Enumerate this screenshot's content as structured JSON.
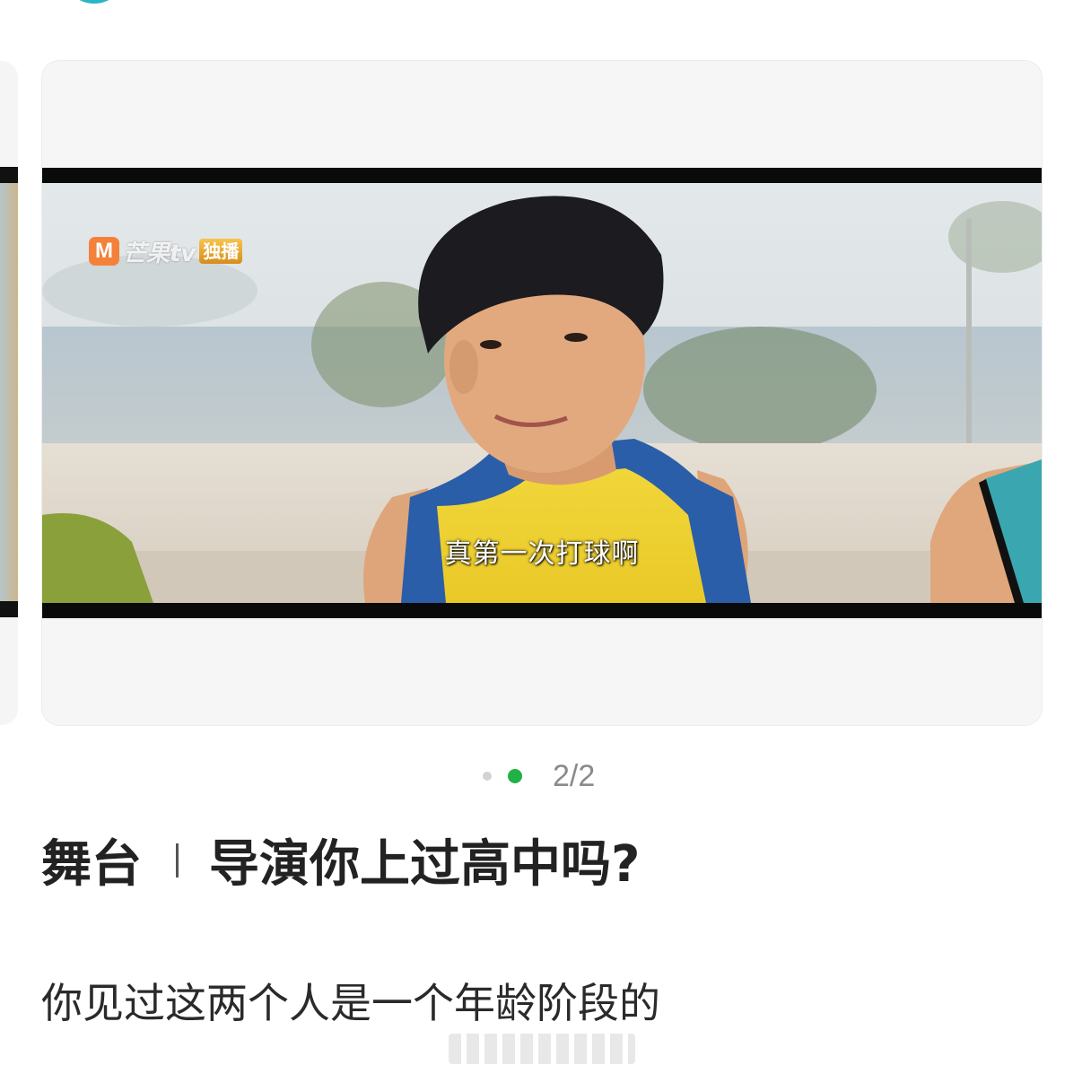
{
  "carousel": {
    "logo_mark": "M",
    "logo_brand": "芒果tv",
    "logo_badge": "独播",
    "subtitle": "真第一次打球啊",
    "page_indicator": "2/2"
  },
  "post": {
    "title_prefix": "舞台",
    "title_main": "导演你上过高中吗?",
    "body": "你见过这两个人是一个年龄阶段的"
  },
  "colors": {
    "accent": "#20b245",
    "avatar": "#2bb6c4"
  }
}
